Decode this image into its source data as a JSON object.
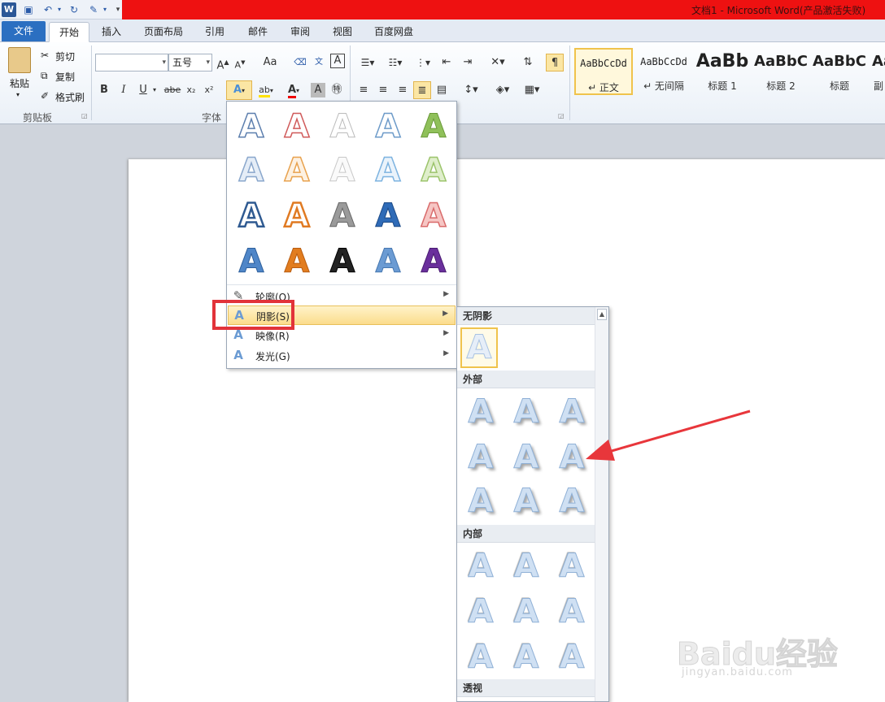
{
  "window": {
    "title": "文档1 - Microsoft Word(产品激活失败)"
  },
  "tabs": [
    "文件",
    "开始",
    "插入",
    "页面布局",
    "引用",
    "邮件",
    "审阅",
    "视图",
    "百度网盘"
  ],
  "clipboard": {
    "paste": "粘贴",
    "cut": "剪切",
    "copy": "复制",
    "format_painter": "格式刷",
    "group_label": "剪贴板"
  },
  "font": {
    "size": "五号",
    "group_label": "字体",
    "change_case": "Aa",
    "clear": "A",
    "bold": "B",
    "italic": "I",
    "underline": "U",
    "strike": "abe",
    "subscript": "x₂",
    "superscript": "x²"
  },
  "styles": [
    {
      "preview": "AaBbCcDd",
      "name": "↵ 正文"
    },
    {
      "preview": "AaBbCcDd",
      "name": "↵ 无间隔"
    },
    {
      "preview": "AaBb",
      "name": "标题 1"
    },
    {
      "preview": "AaBbC",
      "name": "标题 2"
    },
    {
      "preview": "AaBbC",
      "name": "标题"
    },
    {
      "preview": "Aa",
      "name": "副"
    }
  ],
  "effects_menu": {
    "glyph": "A",
    "items": [
      {
        "label": "轮廓(O)",
        "icon": "pen-outline-icon"
      },
      {
        "label": "阴影(S)",
        "icon": "shadow-a-icon"
      },
      {
        "label": "映像(R)",
        "icon": "reflection-a-icon"
      },
      {
        "label": "发光(G)",
        "icon": "glow-a-icon"
      }
    ],
    "highlighted": "阴影(S)"
  },
  "shadow_menu": {
    "glyph": "A",
    "sections": [
      "无阴影",
      "外部",
      "内部",
      "透视"
    ]
  },
  "watermark": {
    "brand": "Baidu经验",
    "url": "jingyan.baidu.com"
  },
  "colors": {
    "title_bar_red": "#ee1111",
    "file_tab": "#2b6fc1",
    "highlight_box": "#e2333a",
    "arrow": "#e8363b"
  }
}
